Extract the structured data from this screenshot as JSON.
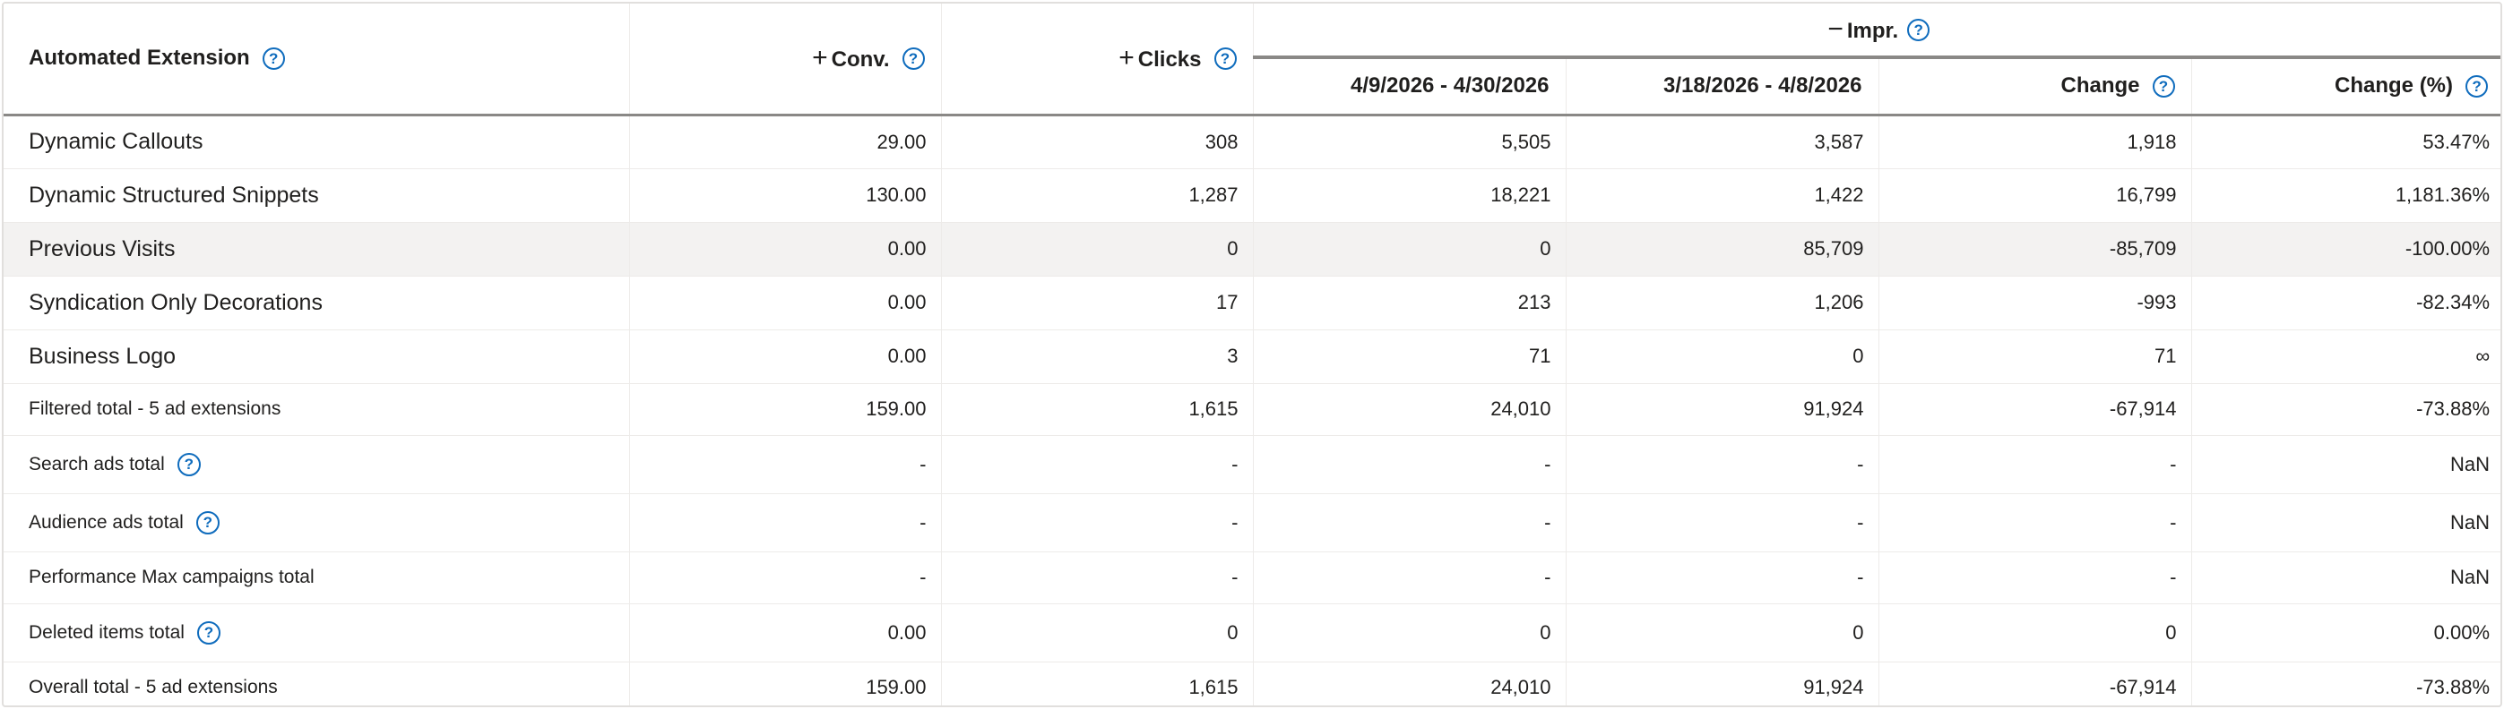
{
  "headers": {
    "name": "Automated Extension",
    "conv": "Conv.",
    "clicks": "Clicks",
    "impr": "Impr.",
    "period_current": "4/9/2026 - 4/30/2026",
    "period_previous": "3/18/2026 - 4/8/2026",
    "change": "Change",
    "change_pct": "Change (%)",
    "expand_glyph": "+",
    "collapse_glyph": "−",
    "help_glyph": "?"
  },
  "rows": [
    {
      "name": "Dynamic Callouts",
      "conv": "29.00",
      "clicks": "308",
      "impr_current": "5,505",
      "impr_previous": "3,587",
      "change": "1,918",
      "change_pct": "53.47%"
    },
    {
      "name": "Dynamic Structured Snippets",
      "conv": "130.00",
      "clicks": "1,287",
      "impr_current": "18,221",
      "impr_previous": "1,422",
      "change": "16,799",
      "change_pct": "1,181.36%"
    },
    {
      "name": "Previous Visits",
      "conv": "0.00",
      "clicks": "0",
      "impr_current": "0",
      "impr_previous": "85,709",
      "change": "-85,709",
      "change_pct": "-100.00%"
    },
    {
      "name": "Syndication Only Decorations",
      "conv": "0.00",
      "clicks": "17",
      "impr_current": "213",
      "impr_previous": "1,206",
      "change": "-993",
      "change_pct": "-82.34%"
    },
    {
      "name": "Business Logo",
      "conv": "0.00",
      "clicks": "3",
      "impr_current": "71",
      "impr_previous": "0",
      "change": "71",
      "change_pct": "∞"
    }
  ],
  "totals": [
    {
      "name": "Filtered total - 5 ad extensions",
      "conv": "159.00",
      "clicks": "1,615",
      "impr_current": "24,010",
      "impr_previous": "91,924",
      "change": "-67,914",
      "change_pct": "-73.88%"
    },
    {
      "name": "Search ads total",
      "conv": "-",
      "clicks": "-",
      "impr_current": "-",
      "impr_previous": "-",
      "change": "-",
      "change_pct": "NaN"
    },
    {
      "name": "Audience ads total",
      "conv": "-",
      "clicks": "-",
      "impr_current": "-",
      "impr_previous": "-",
      "change": "-",
      "change_pct": "NaN"
    },
    {
      "name": "Performance Max campaigns total",
      "conv": "-",
      "clicks": "-",
      "impr_current": "-",
      "impr_previous": "-",
      "change": "-",
      "change_pct": "NaN"
    },
    {
      "name": "Deleted items total",
      "conv": "0.00",
      "clicks": "0",
      "impr_current": "0",
      "impr_previous": "0",
      "change": "0",
      "change_pct": "0.00%"
    },
    {
      "name": "Overall total - 5 ad extensions",
      "conv": "159.00",
      "clicks": "1,615",
      "impr_current": "24,010",
      "impr_previous": "91,924",
      "change": "-67,914",
      "change_pct": "-73.88%"
    }
  ],
  "colors": {
    "help_icon": "#0f6cbd",
    "highlight_row": "#f3f2f1",
    "grid_line": "#edebe9",
    "header_underline": "#8a8886"
  }
}
